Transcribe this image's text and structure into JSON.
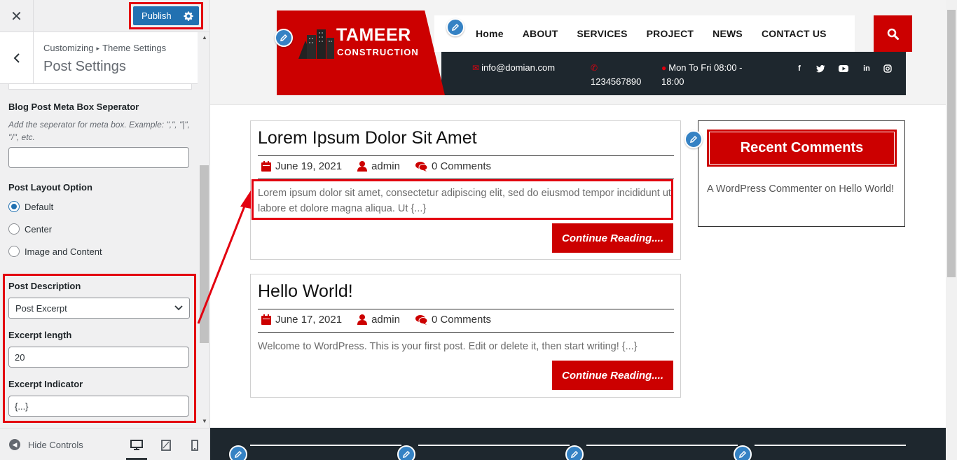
{
  "colors": {
    "accent_red": "#cc0000",
    "wp_blue": "#2271b1",
    "dark_navy": "#1e272e",
    "highlight": "#e3000f"
  },
  "customizer": {
    "close_icon": "close-icon",
    "publish_label": "Publish",
    "breadcrumb": {
      "root": "Customizing",
      "separator": "▸",
      "parent": "Theme Settings"
    },
    "section_title": "Post Settings",
    "controls": {
      "meta_separator": {
        "title": "Blog Post Meta Box Seperator",
        "description": "Add the seperator for meta box. Example: \",\", \"|\", \"/\", etc.",
        "value": ""
      },
      "layout": {
        "title": "Post Layout Option",
        "options": [
          "Default",
          "Center",
          "Image and Content"
        ],
        "selected": "Default"
      },
      "description": {
        "title": "Post Description",
        "selected": "Post Excerpt"
      },
      "excerpt_length": {
        "title": "Excerpt length",
        "value": "20"
      },
      "excerpt_indicator": {
        "title": "Excerpt Indicator",
        "value": "{...}"
      }
    },
    "footer": {
      "hide_controls": "Hide Controls"
    }
  },
  "site": {
    "logo": {
      "name": "TAMEER",
      "tagline": "CONSTRUCTION"
    },
    "nav": [
      "Home",
      "ABOUT",
      "SERVICES",
      "PROJECT",
      "NEWS",
      "CONTACT US"
    ],
    "email": "info@domian.com",
    "phone": "1234567890",
    "hours": "Mon To Fri 08:00 - 18:00",
    "social": [
      "facebook-icon",
      "twitter-icon",
      "youtube-icon",
      "linkedin-icon",
      "instagram-icon"
    ]
  },
  "posts": [
    {
      "title": "Lorem Ipsum Dolor Sit Amet",
      "date": "June 19, 2021",
      "author": "admin",
      "comments": "0 Comments",
      "excerpt": "Lorem ipsum dolor sit amet, consectetur adipiscing elit, sed do eiusmod tempor incididunt ut labore et dolore magna aliqua. Ut {...}",
      "button": "Continue Reading...."
    },
    {
      "title": "Hello World!",
      "date": "June 17, 2021",
      "author": "admin",
      "comments": "0 Comments",
      "excerpt": "Welcome to WordPress. This is your first post. Edit or delete it, then start writing! {...}",
      "button": "Continue Reading...."
    }
  ],
  "sidebar_widget": {
    "title": "Recent Comments",
    "commenter": "A WordPress Commenter",
    "on": "on",
    "post_link": "Hello World!"
  }
}
